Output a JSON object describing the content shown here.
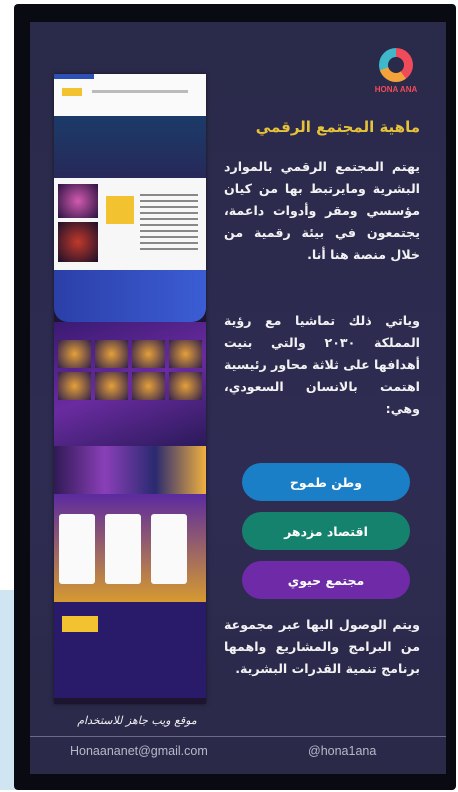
{
  "brand": {
    "logo_text": "HONA ANA"
  },
  "section": {
    "title": "ماهية المجتمع الرقمي"
  },
  "paragraphs": {
    "p1": "يهتم المجتمع الرقمي بالموارد البشرية ومايرتبط بها من كيان مؤسسي ومقر وأدوات داعمة، يجتمعون في بيئة رقمية من خلال منصة هنا أنا.",
    "p2": "وياتي ذلك تماشيا مع رؤية المملكة ٢٠٣٠ والتي بنيت أهدافها على ثلاثة محاور رئيسية اهتمت بالانسان السعودي، وهي:",
    "p3": "ويتم الوصول اليها عبر مجموعة من البرامج والمشاريع واهمها برنامج تنمية القدرات البشرية."
  },
  "pillars": [
    "وطن طموح",
    "اقتصاد مزدهر",
    "مجتمع حيوي"
  ],
  "mockup": {
    "caption": "موقع ويب جاهز للاستخدام"
  },
  "footer": {
    "email": "Honaananet@gmail.com",
    "handle": "@hona1ana"
  }
}
